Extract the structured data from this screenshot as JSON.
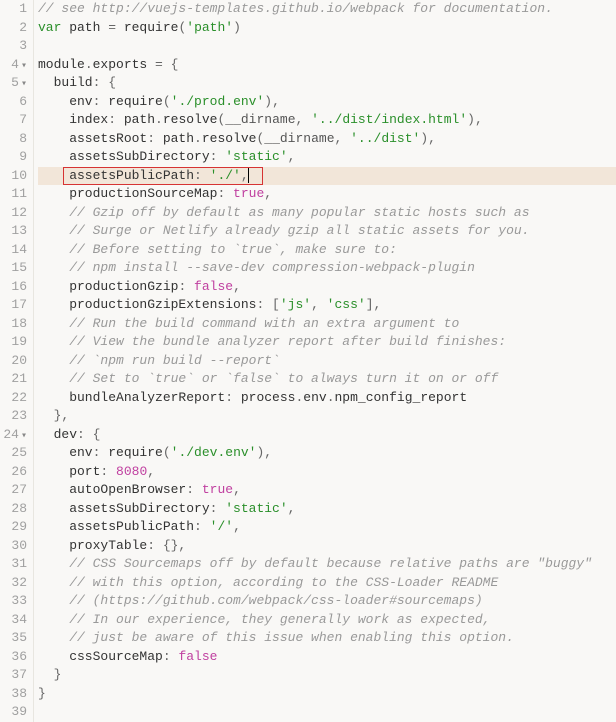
{
  "lines": [
    {
      "n": "1",
      "fold": "",
      "t": [
        [
          "comment",
          "// see http://vuejs-templates.github.io/webpack for documentation."
        ]
      ]
    },
    {
      "n": "2",
      "fold": "",
      "t": [
        [
          "kw",
          "var"
        ],
        [
          "id",
          " path "
        ],
        [
          "punc",
          "="
        ],
        [
          "id",
          " require"
        ],
        [
          "punc",
          "("
        ],
        [
          "str",
          "'path'"
        ],
        [
          "punc",
          ")"
        ]
      ]
    },
    {
      "n": "3",
      "fold": "",
      "t": []
    },
    {
      "n": "4",
      "fold": "▾",
      "t": [
        [
          "id",
          "module"
        ],
        [
          "punc",
          "."
        ],
        [
          "id",
          "exports "
        ],
        [
          "punc",
          "="
        ],
        [
          "punc",
          " {"
        ]
      ]
    },
    {
      "n": "5",
      "fold": "▾",
      "t": [
        [
          "id",
          "  build"
        ],
        [
          "punc",
          ":"
        ],
        [
          "punc",
          " {"
        ]
      ]
    },
    {
      "n": "6",
      "fold": "",
      "t": [
        [
          "id",
          "    env"
        ],
        [
          "punc",
          ":"
        ],
        [
          "id",
          " require"
        ],
        [
          "punc",
          "("
        ],
        [
          "str",
          "'./prod.env'"
        ],
        [
          "punc",
          "),"
        ]
      ]
    },
    {
      "n": "7",
      "fold": "",
      "t": [
        [
          "id",
          "    index"
        ],
        [
          "punc",
          ":"
        ],
        [
          "id",
          " path"
        ],
        [
          "punc",
          "."
        ],
        [
          "id",
          "resolve"
        ],
        [
          "punc",
          "("
        ],
        [
          "dark",
          "__dirname"
        ],
        [
          "punc",
          ", "
        ],
        [
          "str",
          "'../dist/index.html'"
        ],
        [
          "punc",
          "),"
        ]
      ]
    },
    {
      "n": "8",
      "fold": "",
      "t": [
        [
          "id",
          "    assetsRoot"
        ],
        [
          "punc",
          ":"
        ],
        [
          "id",
          " path"
        ],
        [
          "punc",
          "."
        ],
        [
          "id",
          "resolve"
        ],
        [
          "punc",
          "("
        ],
        [
          "dark",
          "__dirname"
        ],
        [
          "punc",
          ", "
        ],
        [
          "str",
          "'../dist'"
        ],
        [
          "punc",
          "),"
        ]
      ]
    },
    {
      "n": "9",
      "fold": "",
      "t": [
        [
          "id",
          "    assetsSubDirectory"
        ],
        [
          "punc",
          ":"
        ],
        [
          "str",
          " 'static'"
        ],
        [
          "punc",
          ","
        ]
      ]
    },
    {
      "n": "10",
      "fold": "",
      "hl": true,
      "red": true,
      "t": [
        [
          "id",
          "    assetsPublicPath"
        ],
        [
          "punc",
          ":"
        ],
        [
          "str",
          " './'"
        ],
        [
          "punc",
          ","
        ]
      ]
    },
    {
      "n": "11",
      "fold": "",
      "t": [
        [
          "id",
          "    productionSourceMap"
        ],
        [
          "punc",
          ":"
        ],
        [
          "bool",
          " true"
        ],
        [
          "punc",
          ","
        ]
      ]
    },
    {
      "n": "12",
      "fold": "",
      "t": [
        [
          "id",
          "    "
        ],
        [
          "comment",
          "// Gzip off by default as many popular static hosts such as"
        ]
      ]
    },
    {
      "n": "13",
      "fold": "",
      "t": [
        [
          "id",
          "    "
        ],
        [
          "comment",
          "// Surge or Netlify already gzip all static assets for you."
        ]
      ]
    },
    {
      "n": "14",
      "fold": "",
      "t": [
        [
          "id",
          "    "
        ],
        [
          "comment",
          "// Before setting to `true`, make sure to:"
        ]
      ]
    },
    {
      "n": "15",
      "fold": "",
      "t": [
        [
          "id",
          "    "
        ],
        [
          "comment",
          "// npm install --save-dev compression-webpack-plugin"
        ]
      ]
    },
    {
      "n": "16",
      "fold": "",
      "t": [
        [
          "id",
          "    productionGzip"
        ],
        [
          "punc",
          ":"
        ],
        [
          "bool",
          " false"
        ],
        [
          "punc",
          ","
        ]
      ]
    },
    {
      "n": "17",
      "fold": "",
      "t": [
        [
          "id",
          "    productionGzipExtensions"
        ],
        [
          "punc",
          ": ["
        ],
        [
          "str",
          "'js'"
        ],
        [
          "punc",
          ", "
        ],
        [
          "str",
          "'css'"
        ],
        [
          "punc",
          "],"
        ]
      ]
    },
    {
      "n": "18",
      "fold": "",
      "t": [
        [
          "id",
          "    "
        ],
        [
          "comment",
          "// Run the build command with an extra argument to"
        ]
      ]
    },
    {
      "n": "19",
      "fold": "",
      "t": [
        [
          "id",
          "    "
        ],
        [
          "comment",
          "// View the bundle analyzer report after build finishes:"
        ]
      ]
    },
    {
      "n": "20",
      "fold": "",
      "t": [
        [
          "id",
          "    "
        ],
        [
          "comment",
          "// `npm run build --report`"
        ]
      ]
    },
    {
      "n": "21",
      "fold": "",
      "t": [
        [
          "id",
          "    "
        ],
        [
          "comment",
          "// Set to `true` or `false` to always turn it on or off"
        ]
      ]
    },
    {
      "n": "22",
      "fold": "",
      "t": [
        [
          "id",
          "    bundleAnalyzerReport"
        ],
        [
          "punc",
          ":"
        ],
        [
          "id",
          " process"
        ],
        [
          "punc",
          "."
        ],
        [
          "id",
          "env"
        ],
        [
          "punc",
          "."
        ],
        [
          "id",
          "npm_config_report"
        ]
      ]
    },
    {
      "n": "23",
      "fold": "",
      "t": [
        [
          "punc",
          "  },"
        ]
      ]
    },
    {
      "n": "24",
      "fold": "▾",
      "t": [
        [
          "id",
          "  dev"
        ],
        [
          "punc",
          ":"
        ],
        [
          "punc",
          " {"
        ]
      ]
    },
    {
      "n": "25",
      "fold": "",
      "t": [
        [
          "id",
          "    env"
        ],
        [
          "punc",
          ":"
        ],
        [
          "id",
          " require"
        ],
        [
          "punc",
          "("
        ],
        [
          "str",
          "'./dev.env'"
        ],
        [
          "punc",
          "),"
        ]
      ]
    },
    {
      "n": "26",
      "fold": "",
      "t": [
        [
          "id",
          "    port"
        ],
        [
          "punc",
          ":"
        ],
        [
          "num",
          " 8080"
        ],
        [
          "punc",
          ","
        ]
      ]
    },
    {
      "n": "27",
      "fold": "",
      "t": [
        [
          "id",
          "    autoOpenBrowser"
        ],
        [
          "punc",
          ":"
        ],
        [
          "bool",
          " true"
        ],
        [
          "punc",
          ","
        ]
      ]
    },
    {
      "n": "28",
      "fold": "",
      "t": [
        [
          "id",
          "    assetsSubDirectory"
        ],
        [
          "punc",
          ":"
        ],
        [
          "str",
          " 'static'"
        ],
        [
          "punc",
          ","
        ]
      ]
    },
    {
      "n": "29",
      "fold": "",
      "t": [
        [
          "id",
          "    assetsPublicPath"
        ],
        [
          "punc",
          ":"
        ],
        [
          "str",
          " '/'"
        ],
        [
          "punc",
          ","
        ]
      ]
    },
    {
      "n": "30",
      "fold": "",
      "t": [
        [
          "id",
          "    proxyTable"
        ],
        [
          "punc",
          ":"
        ],
        [
          "punc",
          " {},"
        ]
      ]
    },
    {
      "n": "31",
      "fold": "",
      "t": [
        [
          "id",
          "    "
        ],
        [
          "comment",
          "// CSS Sourcemaps off by default because relative paths are \"buggy\""
        ]
      ]
    },
    {
      "n": "32",
      "fold": "",
      "t": [
        [
          "id",
          "    "
        ],
        [
          "comment",
          "// with this option, according to the CSS-Loader README"
        ]
      ]
    },
    {
      "n": "33",
      "fold": "",
      "t": [
        [
          "id",
          "    "
        ],
        [
          "comment",
          "// (https://github.com/webpack/css-loader#sourcemaps)"
        ]
      ]
    },
    {
      "n": "34",
      "fold": "",
      "t": [
        [
          "id",
          "    "
        ],
        [
          "comment",
          "// In our experience, they generally work as expected,"
        ]
      ]
    },
    {
      "n": "35",
      "fold": "",
      "t": [
        [
          "id",
          "    "
        ],
        [
          "comment",
          "// just be aware of this issue when enabling this option."
        ]
      ]
    },
    {
      "n": "36",
      "fold": "",
      "t": [
        [
          "id",
          "    cssSourceMap"
        ],
        [
          "punc",
          ":"
        ],
        [
          "bool",
          " false"
        ]
      ]
    },
    {
      "n": "37",
      "fold": "",
      "t": [
        [
          "punc",
          "  }"
        ]
      ]
    },
    {
      "n": "38",
      "fold": "",
      "t": [
        [
          "punc",
          "}"
        ]
      ]
    },
    {
      "n": "39",
      "fold": "",
      "t": []
    }
  ]
}
